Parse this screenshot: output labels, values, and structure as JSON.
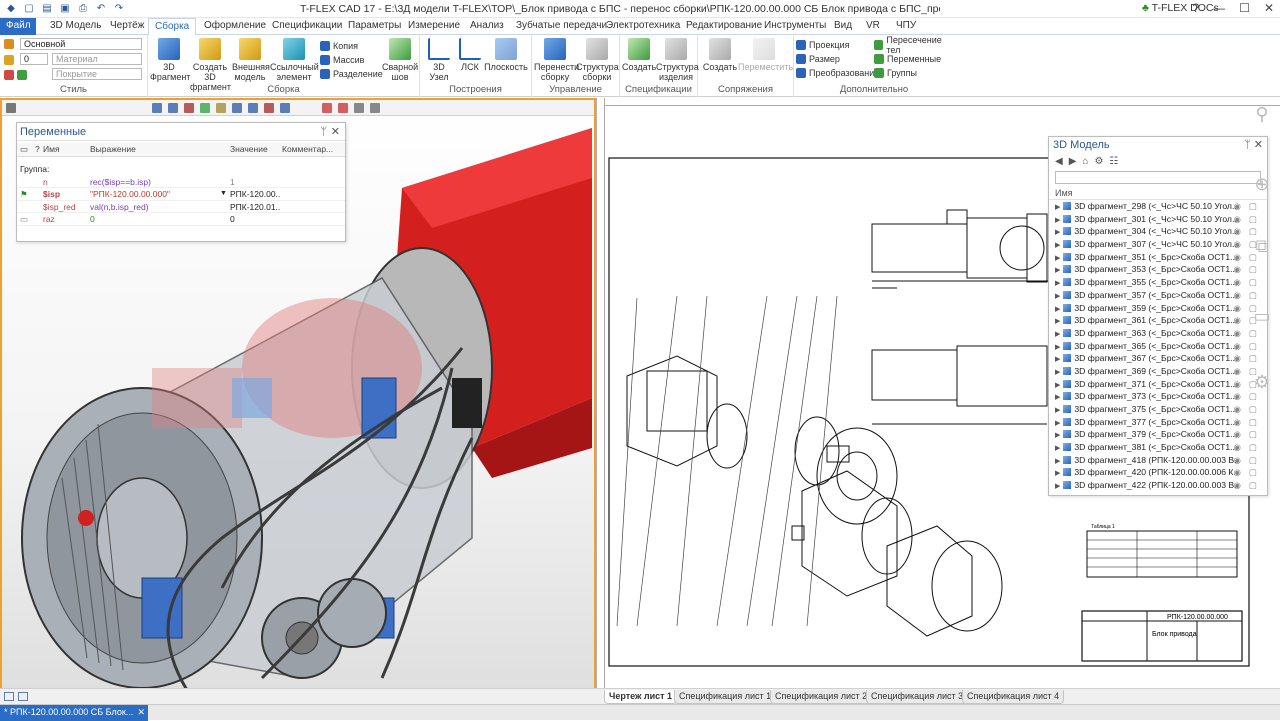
{
  "titlebar": {
    "title": "T-FLEX CAD 17 - E:\\3Д модели T-FLEX\\ТОР\\_Блок привода с БПС - перенос сборки\\РПК-120.00.00.000 СБ Блок привода с БПС_прозрачный.grb",
    "docs_label": "T-FLEX DOCs",
    "help": "?",
    "min": "—",
    "max": "☐",
    "close": "✕"
  },
  "menu": {
    "tabs": [
      "Файл",
      "3D Модель",
      "Чертёж",
      "Сборка",
      "Оформление",
      "Спецификации",
      "Параметры",
      "Измерение",
      "Анализ",
      "Зубчатые передачи",
      "Электротехника",
      "Редактирование",
      "Инструменты",
      "Вид",
      "VR",
      "ЧПУ"
    ],
    "active": "Сборка"
  },
  "ribbon": {
    "style": {
      "label": "Стиль",
      "layer": "Основной",
      "level": "0",
      "material": "Материал",
      "cover": "Покрытие"
    },
    "assembly": {
      "label": "Сборка",
      "buttons": [
        "3D Фрагмент",
        "Создать 3D фрагмент",
        "Внешняя модель",
        "Ссылочный элемент"
      ],
      "small": [
        "Копия",
        "Массив",
        "Разделение"
      ],
      "weld": "Сварной шов"
    },
    "construct": {
      "label": "Построения",
      "buttons": [
        "3D Узел",
        "ЛСК",
        "Плоскость"
      ]
    },
    "control": {
      "label": "Управление",
      "buttons": [
        "Перенести сборку",
        "Структура сборки"
      ]
    },
    "specs": {
      "label": "Спецификации",
      "buttons": [
        "Создать",
        "Структура изделия"
      ]
    },
    "mates": {
      "label": "Сопряжения",
      "buttons": [
        "Создать",
        "Переместить"
      ]
    },
    "extra": {
      "label": "Дополнительно",
      "items": [
        "Проекция",
        "Размер",
        "Преобразование",
        "Пересечение тел",
        "Переменные",
        "Группы"
      ]
    }
  },
  "variables": {
    "title": "Переменные",
    "pin": "ᛘ",
    "close": "✕",
    "headers": [
      "?",
      "Имя",
      "Выражение",
      "Значение",
      "Комментар..."
    ],
    "group": "Группа:",
    "rows": [
      {
        "name": "n",
        "expr": "rec($isp==b.isp)",
        "value": "1"
      },
      {
        "name": "$isp",
        "expr": "\"РПК-120.00.00.000\"",
        "value": "РПК-120.00...."
      },
      {
        "name": "$isp_red",
        "expr": "val(n,b.isp_red)",
        "value": "РПК-120.01...."
      },
      {
        "name": "raz",
        "expr": "0",
        "value": "0"
      }
    ]
  },
  "model_panel": {
    "title": "3D Модель",
    "pin": "ᛘ",
    "close": "✕",
    "column": "Имя",
    "items": [
      "3D фрагмент_298 (<_Чс>ЧС 50.10 Угол...",
      "3D фрагмент_301 (<_Чс>ЧС 50.10 Угол...",
      "3D фрагмент_304 (<_Чс>ЧС 50.10 Угол...",
      "3D фрагмент_307 (<_Чс>ЧС 50.10 Угол...",
      "3D фрагмент_351 (<_Брс>Скоба ОСТ1...",
      "3D фрагмент_353 (<_Брс>Скоба ОСТ1...",
      "3D фрагмент_355 (<_Брс>Скоба ОСТ1...",
      "3D фрагмент_357 (<_Брс>Скоба ОСТ1...",
      "3D фрагмент_359 (<_Брс>Скоба ОСТ1...",
      "3D фрагмент_361 (<_Брс>Скоба ОСТ1...",
      "3D фрагмент_363 (<_Брс>Скоба ОСТ1...",
      "3D фрагмент_365 (<_Брс>Скоба ОСТ1...",
      "3D фрагмент_367 (<_Брс>Скоба ОСТ1...",
      "3D фрагмент_369 (<_Брс>Скоба ОСТ1...",
      "3D фрагмент_371 (<_Брс>Скоба ОСТ1...",
      "3D фрагмент_373 (<_Брс>Скоба ОСТ1...",
      "3D фрагмент_375 (<_Брс>Скоба ОСТ1...",
      "3D фрагмент_377 (<_Брс>Скоба ОСТ1...",
      "3D фрагмент_379 (<_Брс>Скоба ОСТ1...",
      "3D фрагмент_381 (<_Брс>Скоба ОСТ1...",
      "3D фрагмент_418 (РПК-120.00.00.003 В...",
      "3D фрагмент_420 (РПК-120.00.00.006 К...",
      "3D фрагмент_422 (РПК-120.00.00.003 В..."
    ]
  },
  "drawing": {
    "title_block": "РПК-120.00.00.000",
    "name": "Блок привода",
    "table_title": "Таблица 1"
  },
  "sheets": [
    "Чертеж лист 1",
    "Спецификация лист 1",
    "Спецификация лист 2",
    "Спецификация лист 3",
    "Спецификация лист 4"
  ],
  "status": {
    "doc_tab": "* РПК-120.00.00.000 СБ Блок...",
    "doc_close": "✕"
  }
}
